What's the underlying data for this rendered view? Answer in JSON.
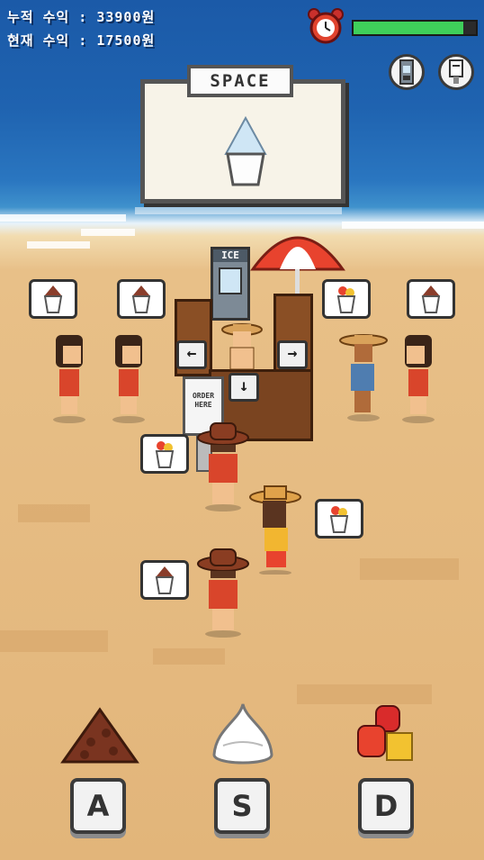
{
  "hud": {
    "total_revenue_label": "누적 수익",
    "total_revenue_value": "33900원",
    "current_revenue_label": "현재 수익",
    "current_revenue_value": "17500원",
    "time_remaining_fraction": 0.9
  },
  "order_panel": {
    "key_label": "SPACE"
  },
  "stand": {
    "machine_label": "ICE",
    "kiosk_text": "ORDER HERE",
    "left_arrow": "←",
    "right_arrow": "→",
    "down_arrow": "↓"
  },
  "toppings": [
    {
      "key": "A",
      "name": "red-bean"
    },
    {
      "key": "S",
      "name": "whipped-cream"
    },
    {
      "key": "D",
      "name": "fruit"
    }
  ],
  "colors": {
    "timer_fill": "#3fcf5a",
    "umbrella_red": "#e8432e",
    "shirt_red": "#d9452b"
  },
  "icons": {
    "clock": "alarm-clock-icon",
    "ice_machine": "ice-machine-icon",
    "kiosk": "kiosk-icon"
  }
}
